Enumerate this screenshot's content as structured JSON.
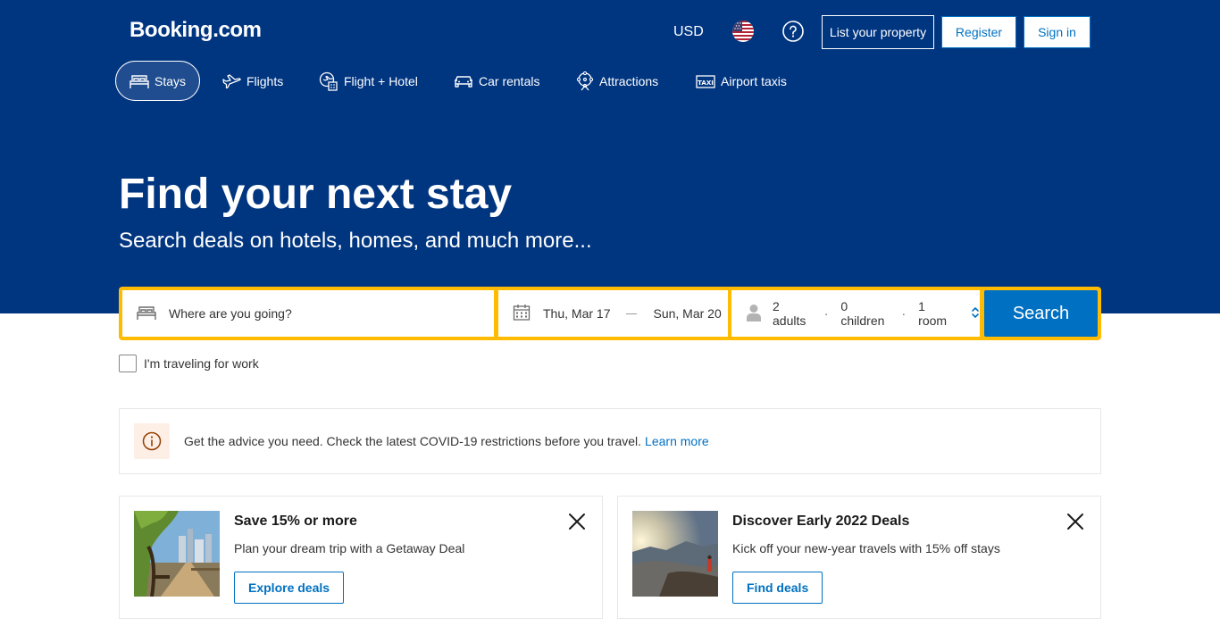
{
  "header": {
    "logo": "Booking.com",
    "currency": "USD",
    "flag_icon": "us-flag-icon",
    "help_icon": "help-icon",
    "list_property": "List your property",
    "register": "Register",
    "sign_in": "Sign in"
  },
  "nav": {
    "tabs": [
      {
        "label": "Stays",
        "icon": "bed-icon",
        "active": true
      },
      {
        "label": "Flights",
        "icon": "plane-icon",
        "active": false
      },
      {
        "label": "Flight + Hotel",
        "icon": "flight-hotel-icon",
        "active": false
      },
      {
        "label": "Car rentals",
        "icon": "car-icon",
        "active": false
      },
      {
        "label": "Attractions",
        "icon": "attractions-icon",
        "active": false
      },
      {
        "label": "Airport taxis",
        "icon": "taxi-icon",
        "active": false
      }
    ]
  },
  "hero": {
    "title": "Find your next stay",
    "subtitle": "Search deals on hotels, homes, and much more..."
  },
  "search": {
    "destination_placeholder": "Where are you going?",
    "checkin": "Thu, Mar 17",
    "checkout": "Sun, Mar 20",
    "adults": "2 adults",
    "children": "0 children",
    "rooms": "1 room",
    "separator": "·",
    "button": "Search",
    "work_label": "I'm traveling for work"
  },
  "advice": {
    "text": "Get the advice you need. Check the latest COVID-19 restrictions before you travel.",
    "link": "Learn more"
  },
  "cards": [
    {
      "title": "Save 15% or more",
      "text": "Plan your dream trip with a Getaway Deal",
      "button": "Explore deals"
    },
    {
      "title": "Discover Early 2022 Deals",
      "text": "Kick off your new-year travels with 15% off stays",
      "button": "Find deals"
    }
  ],
  "colors": {
    "brand_blue": "#003580",
    "link_blue": "#0071c2",
    "search_yellow": "#febb02"
  }
}
